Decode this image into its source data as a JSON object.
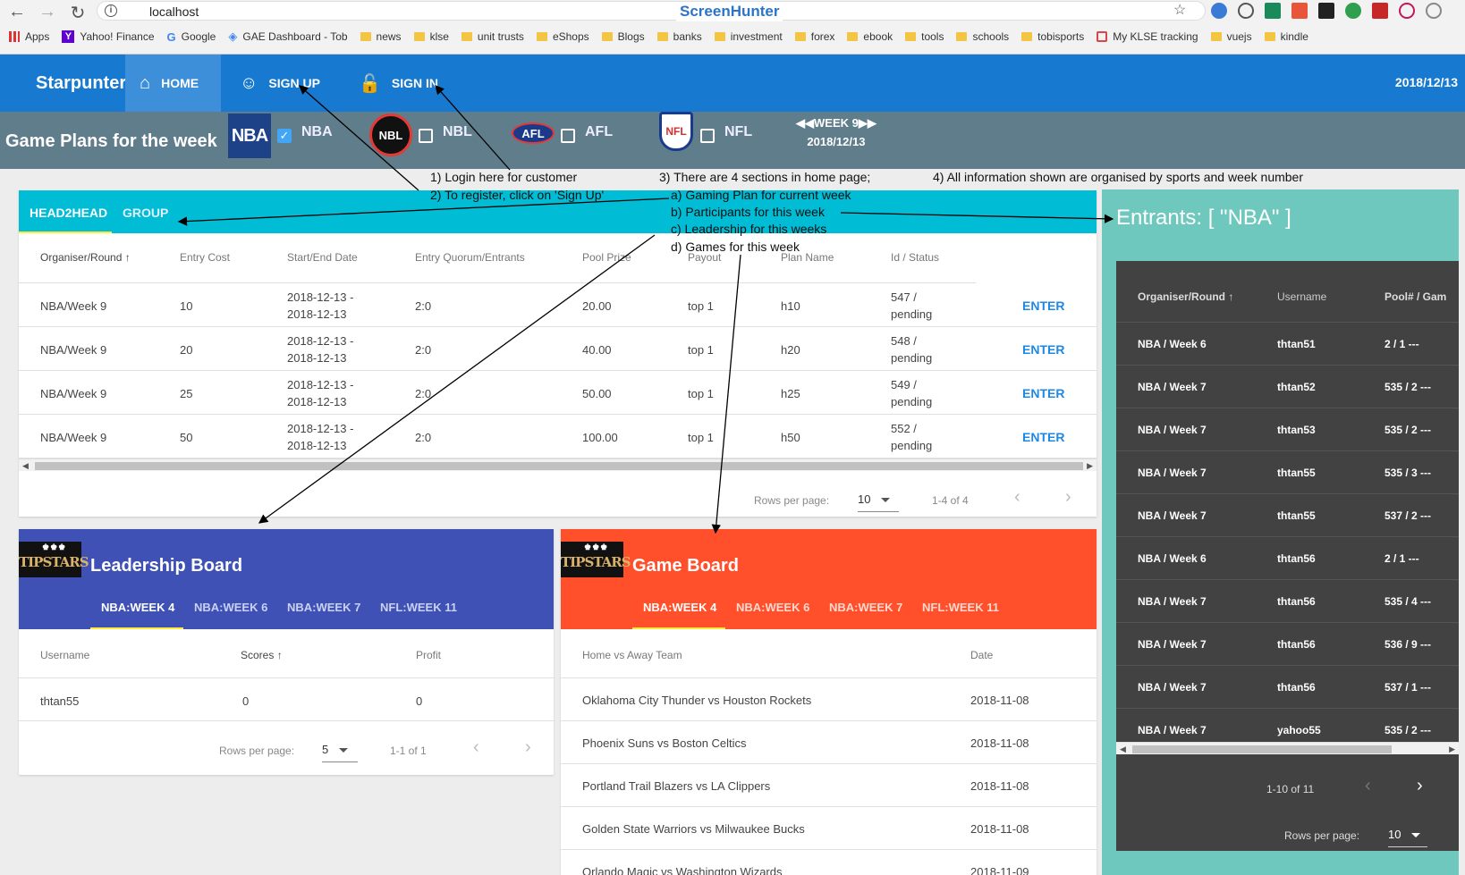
{
  "browser": {
    "url": "localhost",
    "banner": "ScreenHunter",
    "bookmarks": [
      {
        "label": "Apps",
        "icon": "apps-grid-icon"
      },
      {
        "label": "Yahoo! Finance",
        "icon": "yahoo-icon"
      },
      {
        "label": "Google",
        "icon": "google-icon"
      },
      {
        "label": "GAE Dashboard - Tob",
        "icon": "gae-icon"
      },
      {
        "label": "news",
        "icon": "folder-icon"
      },
      {
        "label": "klse",
        "icon": "folder-icon"
      },
      {
        "label": "unit trusts",
        "icon": "folder-icon"
      },
      {
        "label": "eShops",
        "icon": "folder-icon"
      },
      {
        "label": "Blogs",
        "icon": "folder-icon"
      },
      {
        "label": "banks",
        "icon": "folder-icon"
      },
      {
        "label": "investment",
        "icon": "folder-icon"
      },
      {
        "label": "forex",
        "icon": "folder-icon"
      },
      {
        "label": "ebook",
        "icon": "folder-icon"
      },
      {
        "label": "tools",
        "icon": "folder-icon"
      },
      {
        "label": "schools",
        "icon": "folder-icon"
      },
      {
        "label": "tobisports",
        "icon": "folder-icon"
      },
      {
        "label": "My KLSE tracking",
        "icon": "klse-icon"
      },
      {
        "label": "vuejs",
        "icon": "folder-icon"
      },
      {
        "label": "kindle",
        "icon": "folder-icon"
      }
    ]
  },
  "appbar": {
    "brand": "Starpunter",
    "home": "HOME",
    "signup": "SIGN UP",
    "signin": "SIGN IN",
    "date": "2018/12/13"
  },
  "subbar": {
    "title": "Game Plans for the week",
    "sports": [
      {
        "logo": "NBA",
        "label": "NBA",
        "checked": true
      },
      {
        "logo": "NBL",
        "label": "NBL",
        "checked": false
      },
      {
        "logo": "AFL",
        "label": "AFL",
        "checked": false
      },
      {
        "logo": "NFL",
        "label": "NFL",
        "checked": false
      }
    ],
    "week": "WEEK 9",
    "week_date": "2018/12/13"
  },
  "notes": {
    "n1": "1) Login here for customer",
    "n2": "2) To register, click on 'Sign Up'",
    "n3": "3) There are 4 sections in home page;",
    "n3a": "a) Gaming Plan for current week",
    "n3b": "b)  Participants for this week",
    "n3c": "c)  Leadership for this weeks",
    "n3d": "d)  Games for this week",
    "n4": "4) All information shown are organised by sports and week number"
  },
  "plans": {
    "tabs": [
      "HEAD2HEAD",
      "GROUP"
    ],
    "headers": [
      "Organiser/Round",
      "Entry Cost",
      "Start/End Date",
      "Entry Quorum/Entrants",
      "Pool Prize",
      "Payout",
      "Plan Name",
      "Id / Status"
    ],
    "rows": [
      {
        "org": "NBA/Week 9",
        "cost": "10",
        "start": "2018-12-13 -",
        "end": "2018-12-13",
        "quorum": "2:0",
        "pool": "20.00",
        "payout": "top 1",
        "plan": "h10",
        "id": "547 /",
        "status": "pending",
        "action": "ENTER"
      },
      {
        "org": "NBA/Week 9",
        "cost": "20",
        "start": "2018-12-13 -",
        "end": "2018-12-13",
        "quorum": "2:0",
        "pool": "40.00",
        "payout": "top 1",
        "plan": "h20",
        "id": "548 /",
        "status": "pending",
        "action": "ENTER"
      },
      {
        "org": "NBA/Week 9",
        "cost": "25",
        "start": "2018-12-13 -",
        "end": "2018-12-13",
        "quorum": "2:0",
        "pool": "50.00",
        "payout": "top 1",
        "plan": "h25",
        "id": "549 /",
        "status": "pending",
        "action": "ENTER"
      },
      {
        "org": "NBA/Week 9",
        "cost": "50",
        "start": "2018-12-13 -",
        "end": "2018-12-13",
        "quorum": "2:0",
        "pool": "100.00",
        "payout": "top 1",
        "plan": "h50",
        "id": "552 /",
        "status": "pending",
        "action": "ENTER"
      }
    ],
    "rows_per_page_label": "Rows per page:",
    "rows_per_page": "10",
    "range": "1-4 of 4"
  },
  "leadership": {
    "title": "Leadership Board",
    "logo": "TIPSTARS",
    "tabs": [
      "NBA:WEEK 4",
      "NBA:WEEK 6",
      "NBA:WEEK 7",
      "NFL:WEEK 11"
    ],
    "headers": [
      "Username",
      "Scores",
      "Profit"
    ],
    "rows": [
      {
        "user": "thtan55",
        "score": "0",
        "profit": "0"
      }
    ],
    "rows_per_page_label": "Rows per page:",
    "rows_per_page": "5",
    "range": "1-1 of 1"
  },
  "gameboard": {
    "title": "Game Board",
    "logo": "TIPSTARS",
    "tabs": [
      "NBA:WEEK 4",
      "NBA:WEEK 6",
      "NBA:WEEK 7",
      "NFL:WEEK 11"
    ],
    "headers": [
      "Home vs Away Team",
      "Date"
    ],
    "rows": [
      {
        "match": "Oklahoma City Thunder vs Houston Rockets",
        "date": "2018-11-08"
      },
      {
        "match": "Phoenix Suns vs Boston Celtics",
        "date": "2018-11-08"
      },
      {
        "match": "Portland Trail Blazers vs LA Clippers",
        "date": "2018-11-08"
      },
      {
        "match": "Golden State Warriors vs Milwaukee Bucks",
        "date": "2018-11-08"
      },
      {
        "match": "Orlando Magic vs Washington Wizards",
        "date": "2018-11-09"
      }
    ]
  },
  "entrants": {
    "title": "Entrants: [ \"NBA\" ]",
    "headers": [
      "Organiser/Round",
      "Username",
      "Pool# / Gam"
    ],
    "rows": [
      {
        "org": "NBA / Week 6",
        "user": "thtan51",
        "pool": "2 / 1 ---"
      },
      {
        "org": "NBA / Week 7",
        "user": "thtan52",
        "pool": "535 / 2 ---"
      },
      {
        "org": "NBA / Week 7",
        "user": "thtan53",
        "pool": "535 / 2 ---"
      },
      {
        "org": "NBA / Week 7",
        "user": "thtan55",
        "pool": "535 / 3 ---"
      },
      {
        "org": "NBA / Week 7",
        "user": "thtan55",
        "pool": "537 / 2 ---"
      },
      {
        "org": "NBA / Week 6",
        "user": "thtan56",
        "pool": "2 / 1 ---"
      },
      {
        "org": "NBA / Week 7",
        "user": "thtan56",
        "pool": "535 / 4 ---"
      },
      {
        "org": "NBA / Week 7",
        "user": "thtan56",
        "pool": "536 / 9 ---"
      },
      {
        "org": "NBA / Week 7",
        "user": "thtan56",
        "pool": "537 / 1 ---"
      },
      {
        "org": "NBA / Week 7",
        "user": "yahoo55",
        "pool": "535 / 2 ---"
      }
    ],
    "range": "1-10 of 11",
    "rows_per_page_label": "Rows per page:",
    "rows_per_page": "10"
  }
}
